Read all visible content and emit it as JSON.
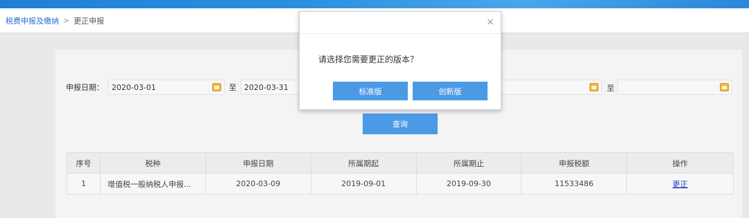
{
  "breadcrumb": {
    "root": "税费申报及缴纳",
    "separator": ">",
    "current": "更正申报"
  },
  "form": {
    "date_label": "申报日期：",
    "start_date": "2020-03-01",
    "to_text_1": "至",
    "end_date": "2020-03-31",
    "to_text_2": "至",
    "third_date": "",
    "fourth_date": ""
  },
  "query_button": "查询",
  "table": {
    "headers": [
      "序号",
      "税种",
      "申报日期",
      "所属期起",
      "所属期止",
      "申报税额",
      "操作"
    ],
    "rows": [
      {
        "no": "1",
        "tax": "增值税一般纳税人申报...",
        "declare_date": "2020-03-09",
        "period_start": "2019-09-01",
        "period_end": "2019-09-30",
        "amount": "11533486",
        "action": "更正"
      }
    ]
  },
  "modal": {
    "close": "×",
    "message": "请选择您需要更正的版本？",
    "btn_standard": "标准版",
    "btn_new": "创新版"
  },
  "colors": {
    "accent": "#4c9ae6",
    "link": "#2a6fcf",
    "icon": "#f0b640"
  }
}
